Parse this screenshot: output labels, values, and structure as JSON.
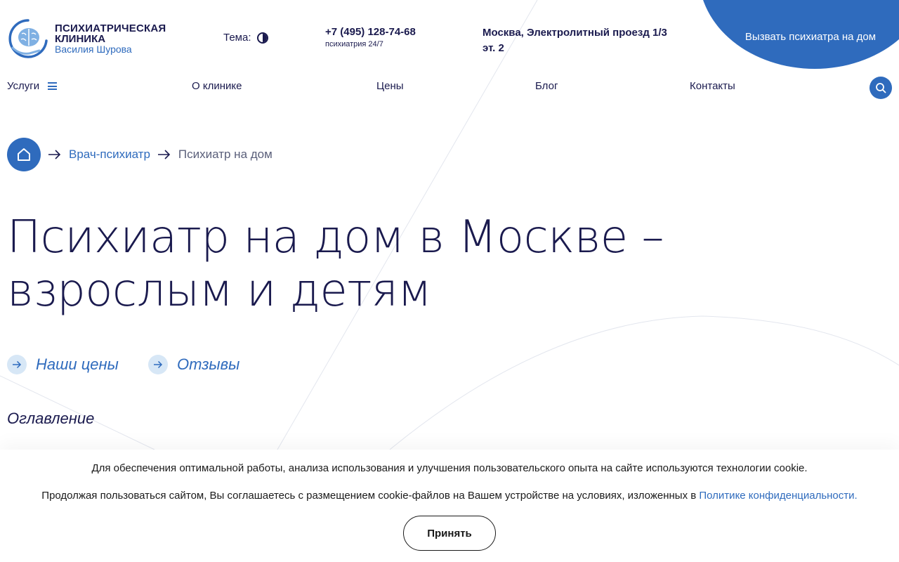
{
  "header": {
    "logo": {
      "line1": "ПСИХИАТРИЧЕСКАЯ",
      "line2": "КЛИНИКА",
      "line3": "Василия Шурова",
      "icon": "brain-hand-icon"
    },
    "theme_label": "Тема:",
    "theme_icon": "contrast-icon",
    "phone": {
      "number": "+7 (495) 128-74-68",
      "subtitle": "психиатрия 24/7"
    },
    "address": "Москва, Электролитный проезд 1/3 эт. 2",
    "cta_label": "Вызвать психиатра на дом"
  },
  "nav": {
    "items": [
      {
        "label": "Услуги"
      },
      {
        "label": "О клинике"
      },
      {
        "label": "Цены"
      },
      {
        "label": "Блог"
      },
      {
        "label": "Контакты"
      }
    ],
    "search_icon": "search-icon",
    "burger_icon": "burger-menu-icon"
  },
  "breadcrumbs": {
    "home_icon": "home-icon",
    "items": [
      {
        "label": "Врач-психиатр",
        "link": true
      },
      {
        "label": "Психиатр на дом",
        "link": false
      }
    ]
  },
  "page": {
    "title": "Психиатр на дом в Москве – взрослым и детям",
    "quick_links": [
      {
        "label": "Наши цены"
      },
      {
        "label": "Отзывы"
      }
    ],
    "toc_title": "Оглавление"
  },
  "cookie": {
    "line1": "Для обеспечения оптимальной работы, анализа использования и улучшения пользовательского опыта на сайте используются технологии cookie.",
    "line2_prefix": "Продолжая пользоваться сайтом, Вы соглашаетесь с размещением cookie-файлов на Вашем устройстве на условиях, изложенных в ",
    "line2_link": "Политике конфиденциальности",
    "line2_suffix": ".",
    "accept_label": "Принять"
  },
  "colors": {
    "accent": "#2f6bbd",
    "text_dark": "#1a1a4e",
    "accent_light": "#d7e7f6"
  }
}
